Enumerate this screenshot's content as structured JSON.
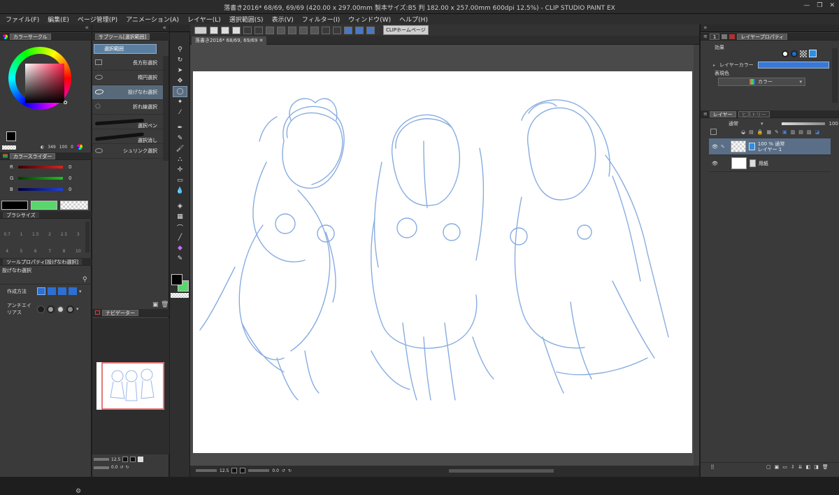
{
  "window": {
    "title": "落書き2016* 68/69, 69/69 (420.00 x 297.00mm 製本サイズ:B5 判 182.00 x 257.00mm 600dpi 12.5%) - CLIP STUDIO PAINT EX"
  },
  "menu": [
    "ファイル(F)",
    "編集(E)",
    "ページ管理(P)",
    "アニメーション(A)",
    "レイヤー(L)",
    "選択範囲(S)",
    "表示(V)",
    "フィルター(I)",
    "ウィンドウ(W)",
    "ヘルプ(H)"
  ],
  "command_bar": {
    "clip_home": "CLIPホームページ"
  },
  "color_circle": {
    "title": "カラーサークル",
    "hue_value": "349",
    "sat_value": "100",
    "bri_value": "0"
  },
  "color_slider": {
    "title": "カラースライダー",
    "rows": [
      {
        "label": "R",
        "value": "0",
        "color": "#e02020"
      },
      {
        "label": "G",
        "value": "0",
        "color": "#20c020"
      },
      {
        "label": "B",
        "value": "0",
        "color": "#2040e0"
      }
    ]
  },
  "brush_size": {
    "title": "ブラシサイズ",
    "row1": [
      "0.7",
      "1",
      "1.5",
      "2",
      "2.5",
      "3"
    ],
    "row2": [
      "4",
      "5",
      "6",
      "7",
      "8",
      "10"
    ]
  },
  "tool_property": {
    "title": "ツールプロパティ[投げなわ選択]",
    "tool_name": "投げなわ選択",
    "method_label": "作成方法",
    "antialias_label": "アンチエイリアス"
  },
  "sub_tool": {
    "title": "サブツール[選択範囲]",
    "group": "選択範囲",
    "items": [
      "長方形選択",
      "楕円選択",
      "投げなわ選択",
      "折れ線選択",
      "選択ペン",
      "選択消し",
      "シュリンク選択"
    ],
    "selected_index": 2
  },
  "navigator": {
    "title": "ナビゲーター",
    "zoom": "12.5",
    "angle": "0.0"
  },
  "document": {
    "tab": "落書き2016* 68/69, 69/69",
    "zoom": "12.5",
    "angle": "0.0"
  },
  "layer_property": {
    "title": "レイヤープロパティ",
    "effect_label": "効果",
    "layer_color_label": "レイヤーカラー",
    "expression_label": "表現色",
    "expression_value": "カラー"
  },
  "layers": {
    "tab": "レイヤー",
    "tab2": "ヒストリー",
    "blend": "通常",
    "opacity": "100",
    "items": [
      {
        "line1": "100 % 通常",
        "line2": "レイヤー 1",
        "selected": true
      },
      {
        "line1": "",
        "line2": "用紙",
        "selected": false
      }
    ]
  },
  "colors": {
    "main": "#000000",
    "sub": "#5ad66c",
    "accent": "#3a78d8",
    "sketch": "#7ba4de"
  }
}
